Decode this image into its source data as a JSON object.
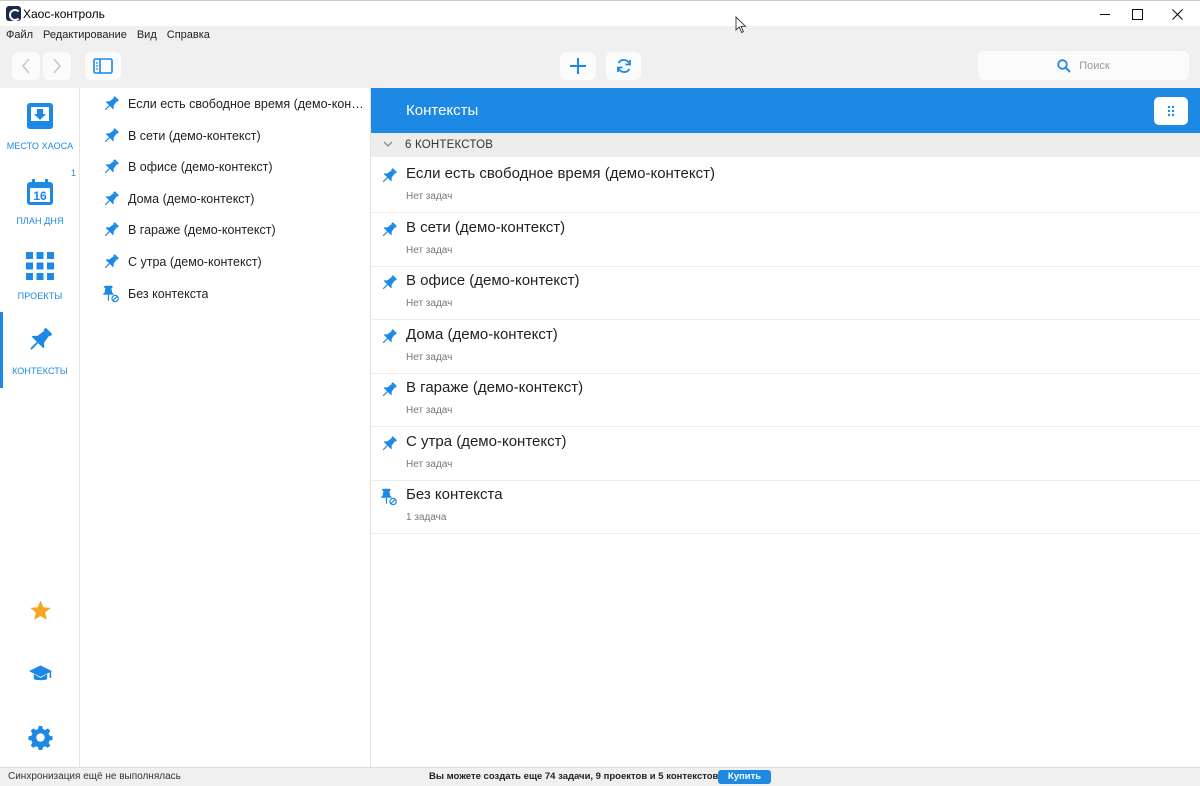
{
  "window": {
    "title": "Хаос-контроль"
  },
  "menu": [
    "Файл",
    "Редактирование",
    "Вид",
    "Справка"
  ],
  "toolbar": {
    "search_placeholder": "Поиск"
  },
  "nav": {
    "items": [
      {
        "label": "МЕСТО ХАОСА",
        "icon": "inbox-download-icon"
      },
      {
        "label": "ПЛАН ДНЯ",
        "icon": "calendar-icon",
        "calendar_day": "16",
        "badge": "1"
      },
      {
        "label": "ПРОЕКТЫ",
        "icon": "grid-icon"
      },
      {
        "label": "КОНТЕКСТЫ",
        "icon": "pushpin-icon",
        "active": true
      }
    ],
    "bottom_icons": [
      "star-icon",
      "graduation-cap-icon",
      "gear-icon"
    ]
  },
  "sidebar_list": [
    {
      "label": "Если есть свободное время (демо-контек...",
      "icon": "pushpin-icon"
    },
    {
      "label": "В сети (демо-контекст)",
      "icon": "pushpin-icon"
    },
    {
      "label": "В офисе (демо-контекст)",
      "icon": "pushpin-icon"
    },
    {
      "label": "Дома (демо-контекст)",
      "icon": "pushpin-icon"
    },
    {
      "label": "В гараже (демо-контекст)",
      "icon": "pushpin-icon"
    },
    {
      "label": "С утра (демо-контекст)",
      "icon": "pushpin-icon"
    },
    {
      "label": "Без контекста",
      "icon": "no-context-icon"
    }
  ],
  "main": {
    "title": "Контексты",
    "group_label": "6 КОНТЕКСТОВ",
    "rows": [
      {
        "title": "Если есть свободное время (демо-контекст)",
        "subtitle": "Нет задач",
        "icon": "pushpin-icon"
      },
      {
        "title": "В сети (демо-контекст)",
        "subtitle": "Нет задач",
        "icon": "pushpin-icon"
      },
      {
        "title": "В офисе (демо-контекст)",
        "subtitle": "Нет задач",
        "icon": "pushpin-icon"
      },
      {
        "title": "Дома (демо-контекст)",
        "subtitle": "Нет задач",
        "icon": "pushpin-icon"
      },
      {
        "title": "В гараже (демо-контекст)",
        "subtitle": "Нет задач",
        "icon": "pushpin-icon"
      },
      {
        "title": "С утра (демо-контекст)",
        "subtitle": "Нет задач",
        "icon": "pushpin-icon"
      },
      {
        "title": "Без контекста",
        "subtitle": "1 задача",
        "icon": "no-context-icon"
      }
    ]
  },
  "status": {
    "sync": "Синхронизация ещё не выполнялась",
    "limit": "Вы можете создать еще 74 задачи, 9 проектов и 5 контекстов",
    "buy_label": "Купить"
  },
  "colors": {
    "accent": "#1e88e5",
    "star": "#f5a623"
  }
}
